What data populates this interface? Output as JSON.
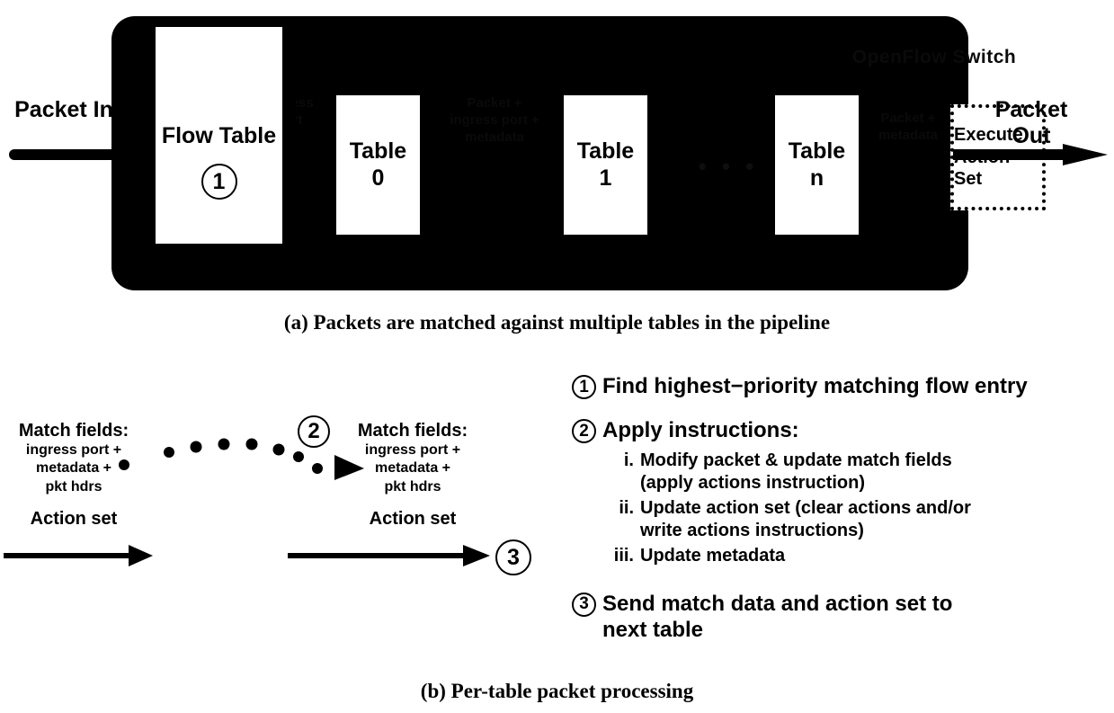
{
  "panel_a": {
    "switch_title": "OpenFlow Switch",
    "packet_in": "Packet\nIn",
    "packet_out": "Packet\nOut",
    "tables": [
      {
        "name": "Table",
        "index": "0"
      },
      {
        "name": "Table",
        "index": "1"
      },
      {
        "name": "Table",
        "index": "n"
      }
    ],
    "ellipsis": "• • •",
    "execute_box": "Execute\nAction\nSet",
    "notes": {
      "ingress": "Ingress\nport",
      "between_0": "Packet +\ningress port +\nmetadata",
      "between_n": "Packet +\nmetadata"
    }
  },
  "caption_a": "(a) Packets are matched against multiple tables in the pipeline",
  "caption_b": "(b) Per-table packet processing",
  "panel_b": {
    "flow_table_label": "Flow\nTable",
    "step_marker_1": "1",
    "step_marker_2": "2",
    "step_marker_3": "3",
    "left": {
      "match_fields_heading": "Match fields:",
      "match_fields_detail": "ingress port +\nmetadata +\npkt hdrs",
      "action_set": "Action set"
    },
    "right": {
      "match_fields_heading": "Match fields:",
      "match_fields_detail": "ingress port +\nmetadata +\npkt hdrs",
      "action_set": "Action set"
    }
  },
  "steps": {
    "step1": {
      "marker": "1",
      "text": "Find highest−priority matching flow entry"
    },
    "step2": {
      "marker": "2",
      "text": "Apply instructions:",
      "substeps": [
        {
          "marker": "i.",
          "text": "Modify packet & update match fields\n(apply actions instruction)"
        },
        {
          "marker": "ii.",
          "text": "Update action set (clear actions and/or\nwrite actions instructions)"
        },
        {
          "marker": "iii.",
          "text": "Update metadata"
        }
      ]
    },
    "step3": {
      "marker": "3",
      "text": "Send match data and action set to\nnext table"
    }
  },
  "colors": {
    "background": "#ffffff",
    "switch_fill": "#000000",
    "table_fill": "#ffffff",
    "ink": "#000000",
    "faint_ink": "#0a0a0a"
  }
}
